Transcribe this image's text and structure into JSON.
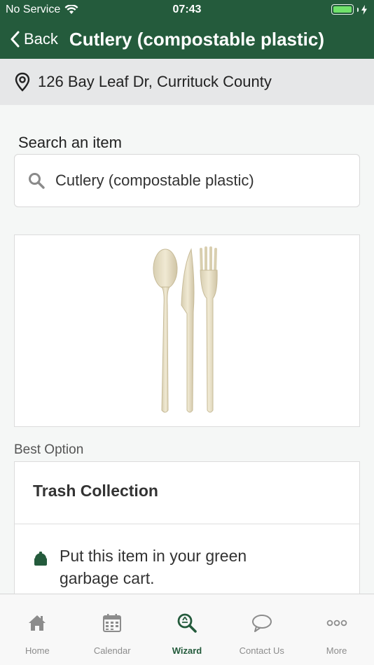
{
  "status_bar": {
    "carrier": "No Service",
    "time": "07:43"
  },
  "nav": {
    "back_label": "Back",
    "title": "Cutlery (compostable plastic)"
  },
  "address": {
    "text": "126 Bay Leaf Dr, Currituck County"
  },
  "search": {
    "label": "Search an item",
    "value": "Cutlery (compostable plastic)"
  },
  "item_image": {
    "icon": "cutlery-image"
  },
  "result": {
    "section_label": "Best Option",
    "title": "Trash Collection",
    "instruction": "Put this item in your green garbage cart."
  },
  "tabs": [
    {
      "label": "Home",
      "icon": "home-icon"
    },
    {
      "label": "Calendar",
      "icon": "calendar-icon"
    },
    {
      "label": "Wizard",
      "icon": "wizard-icon"
    },
    {
      "label": "Contact Us",
      "icon": "chat-icon"
    },
    {
      "label": "More",
      "icon": "more-icon"
    }
  ],
  "colors": {
    "brand_green": "#245b3c",
    "battery_green": "#6fe26a",
    "inactive_tab": "#8c8c8c"
  }
}
